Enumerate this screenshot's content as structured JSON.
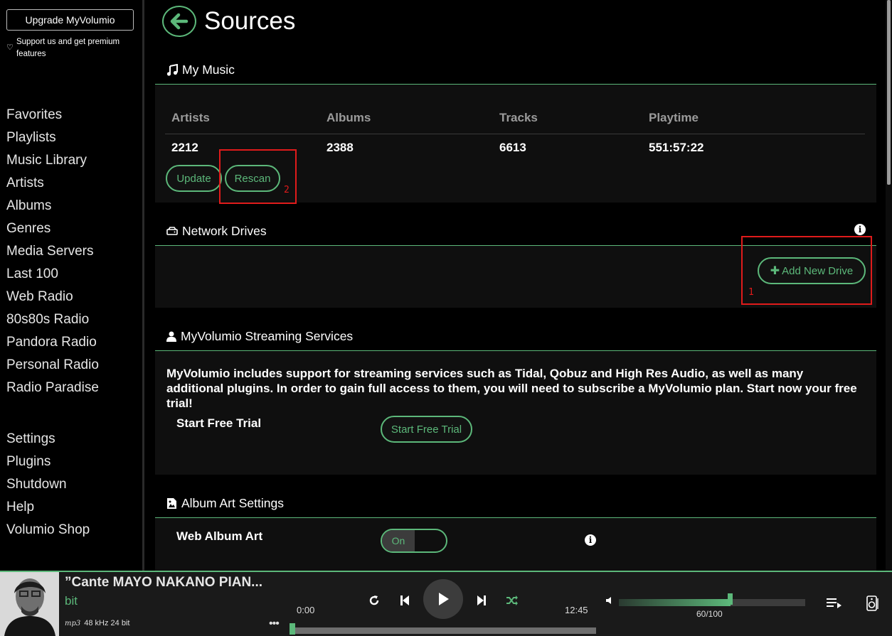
{
  "sidebar": {
    "upgrade_label": "Upgrade MyVolumio",
    "support_text": "Support us and get premium features",
    "nav": [
      "Favorites",
      "Playlists",
      "Music Library",
      "Artists",
      "Albums",
      "Genres",
      "Media Servers",
      "Last 100",
      "Web Radio",
      "80s80s Radio",
      "Pandora Radio",
      "Personal Radio",
      "Radio Paradise"
    ],
    "nav2": [
      "Settings",
      "Plugins",
      "Shutdown",
      "Help",
      "Volumio Shop"
    ]
  },
  "page": {
    "title": "Sources"
  },
  "my_music": {
    "heading": "My Music",
    "columns": [
      "Artists",
      "Albums",
      "Tracks",
      "Playtime"
    ],
    "values": [
      "2212",
      "2388",
      "6613",
      "551:57:22"
    ],
    "update_label": "Update",
    "rescan_label": "Rescan",
    "annotation": "2"
  },
  "network_drives": {
    "heading": "Network Drives",
    "add_label": "Add New Drive",
    "annotation": "1"
  },
  "streaming": {
    "heading": "MyVolumio Streaming Services",
    "description": "MyVolumio includes support for streaming services such as Tidal, Qobuz and High Res Audio, as well as many additional plugins. In order to gain full access to them, you will need to subscribe a MyVolumio plan. Start now your free trial!",
    "row_label": "Start Free Trial",
    "button_label": "Start Free Trial"
  },
  "album_art": {
    "heading": "Album Art Settings",
    "row_label": "Web Album Art",
    "toggle_label": "On"
  },
  "player": {
    "title": "”Cante MAYO NAKANO PIAN...",
    "artist": "bit",
    "format_badge": "mp3",
    "format": "48 kHz 24 bit",
    "elapsed": "0:00",
    "total": "12:45",
    "seek_fraction": 0,
    "volume": 60,
    "volume_text": "60/100"
  },
  "colors": {
    "accent": "#5cb87a",
    "annotation": "#e01b1b"
  }
}
